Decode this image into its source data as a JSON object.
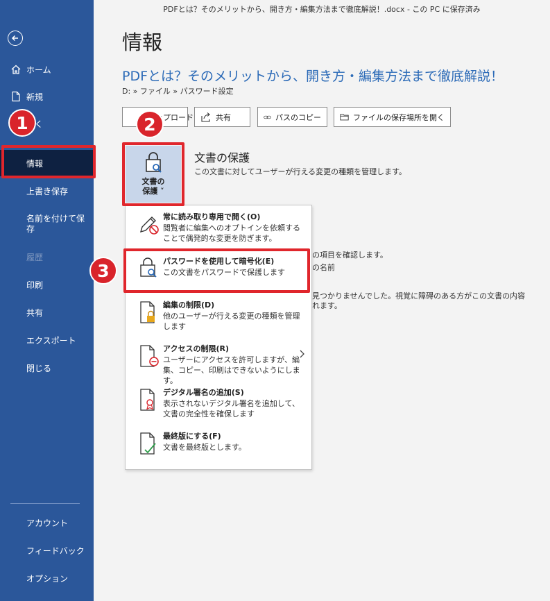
{
  "window": {
    "title": "PDFとは？そのメリットから、開き方・編集方法まで徹底解説！.docx  -  この PC に保存済み"
  },
  "sidebar": {
    "items": [
      {
        "label": "ホーム"
      },
      {
        "label": "新規"
      },
      {
        "label": "開く"
      },
      {
        "label": "情報"
      },
      {
        "label": "上書き保存"
      },
      {
        "label": "名前を付けて保存"
      },
      {
        "label": "履歴"
      },
      {
        "label": "印刷"
      },
      {
        "label": "共有"
      },
      {
        "label": "エクスポート"
      },
      {
        "label": "閉じる"
      }
    ],
    "bottom": [
      {
        "label": "アカウント"
      },
      {
        "label": "フィードバック"
      },
      {
        "label": "オプション"
      }
    ]
  },
  "main": {
    "page_title": "情報",
    "doc_title": "PDFとは？そのメリットから、開き方・編集方法まで徹底解説！",
    "breadcrumb": "D: » ファイル » パスワード設定",
    "toolbar": {
      "upload": "アップロード",
      "share": "共有",
      "copy_path": "パスのコピー",
      "open_location": "ファイルの保存場所を開く"
    },
    "protect": {
      "tile_label_1": "文書の",
      "tile_label_2": "保護 ˅",
      "title": "文書の保護",
      "desc": "この文書に対してユーザーが行える変更の種類を管理します。"
    },
    "background": {
      "line1": "の項目を確認します。",
      "line2": "の名前",
      "line3": "見つかりませんでした。視覚に障碍のある方がこの文書の内容",
      "line4": "れます。"
    }
  },
  "menu": {
    "items": [
      {
        "title": "常に読み取り専用で開く(O)",
        "desc": "閲覧者に編集へのオプトインを依頼することで偶発的な変更を防ぎます。"
      },
      {
        "title": "パスワードを使用して暗号化(E)",
        "desc": "この文書をパスワードで保護します"
      },
      {
        "title": "編集の制限(D)",
        "desc": "他のユーザーが行える変更の種類を管理します"
      },
      {
        "title": "アクセスの制限(R)",
        "desc": "ユーザーにアクセスを許可しますが、編集、コピー、印刷はできないようにします。"
      },
      {
        "title": "デジタル署名の追加(S)",
        "desc": "表示されないデジタル署名を追加して、文書の完全性を確保します"
      },
      {
        "title": "最終版にする(F)",
        "desc": "文書を最終版とします。"
      }
    ]
  },
  "annotations": {
    "step1": "1",
    "step2": "2",
    "step3": "3"
  },
  "colors": {
    "sidebar": "#2b579a",
    "selected": "#0e2141",
    "accent_text": "#2b6ab7",
    "annotation_red": "#e0262c"
  }
}
